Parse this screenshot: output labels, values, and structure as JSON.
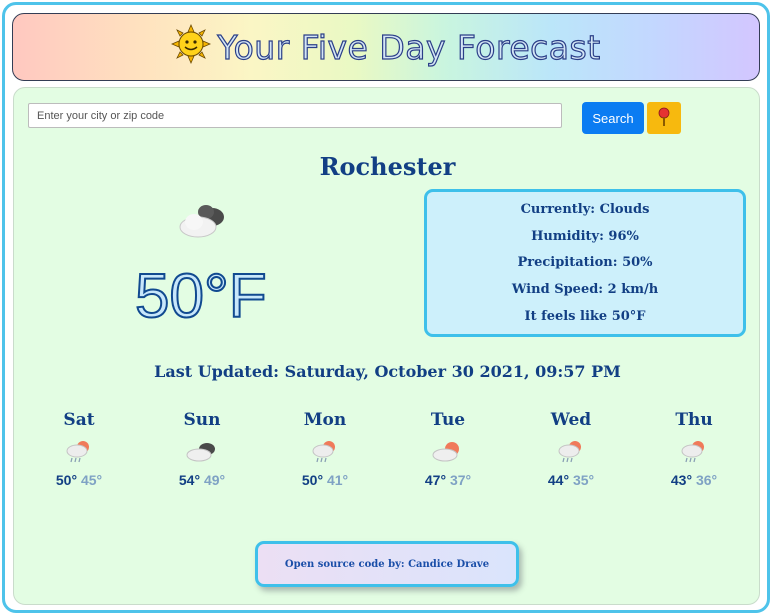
{
  "header": {
    "title": "Your Five Day Forecast",
    "icon": "sun-face-icon"
  },
  "search": {
    "placeholder": "Enter your city or zip code",
    "value": "",
    "button_label": "Search",
    "location_icon": "map-pin-icon"
  },
  "current": {
    "city": "Rochester",
    "icon": "cloud-icon",
    "temperature": "50°F",
    "conditions": "Currently: Clouds",
    "humidity": "Humidity: 96%",
    "precipitation": "Precipitation: 50%",
    "wind": "Wind Speed: 2 km/h",
    "feels_like": "It feels like 50°F",
    "last_updated": "Last Updated: Saturday, October 30 2021, 09:57 PM"
  },
  "forecast": [
    {
      "day": "Sat",
      "icon": "rain-cloud-icon",
      "high": "50°",
      "low": "45°"
    },
    {
      "day": "Sun",
      "icon": "cloud-icon",
      "high": "54°",
      "low": "49°"
    },
    {
      "day": "Mon",
      "icon": "rain-cloud-icon",
      "high": "50°",
      "low": "41°"
    },
    {
      "day": "Tue",
      "icon": "partly-cloudy-icon",
      "high": "47°",
      "low": "37°"
    },
    {
      "day": "Wed",
      "icon": "rain-cloud-icon",
      "high": "44°",
      "low": "35°"
    },
    {
      "day": "Thu",
      "icon": "rain-cloud-icon",
      "high": "43°",
      "low": "36°"
    }
  ],
  "footer": {
    "credit": "Open source code by: Candice Drave"
  },
  "colors": {
    "accent_blue": "#0b7cf2",
    "location_yellow": "#f7b90e",
    "panel_green": "#e3fde3",
    "text_navy": "#123f84",
    "border_cyan": "#3ec0ea"
  }
}
